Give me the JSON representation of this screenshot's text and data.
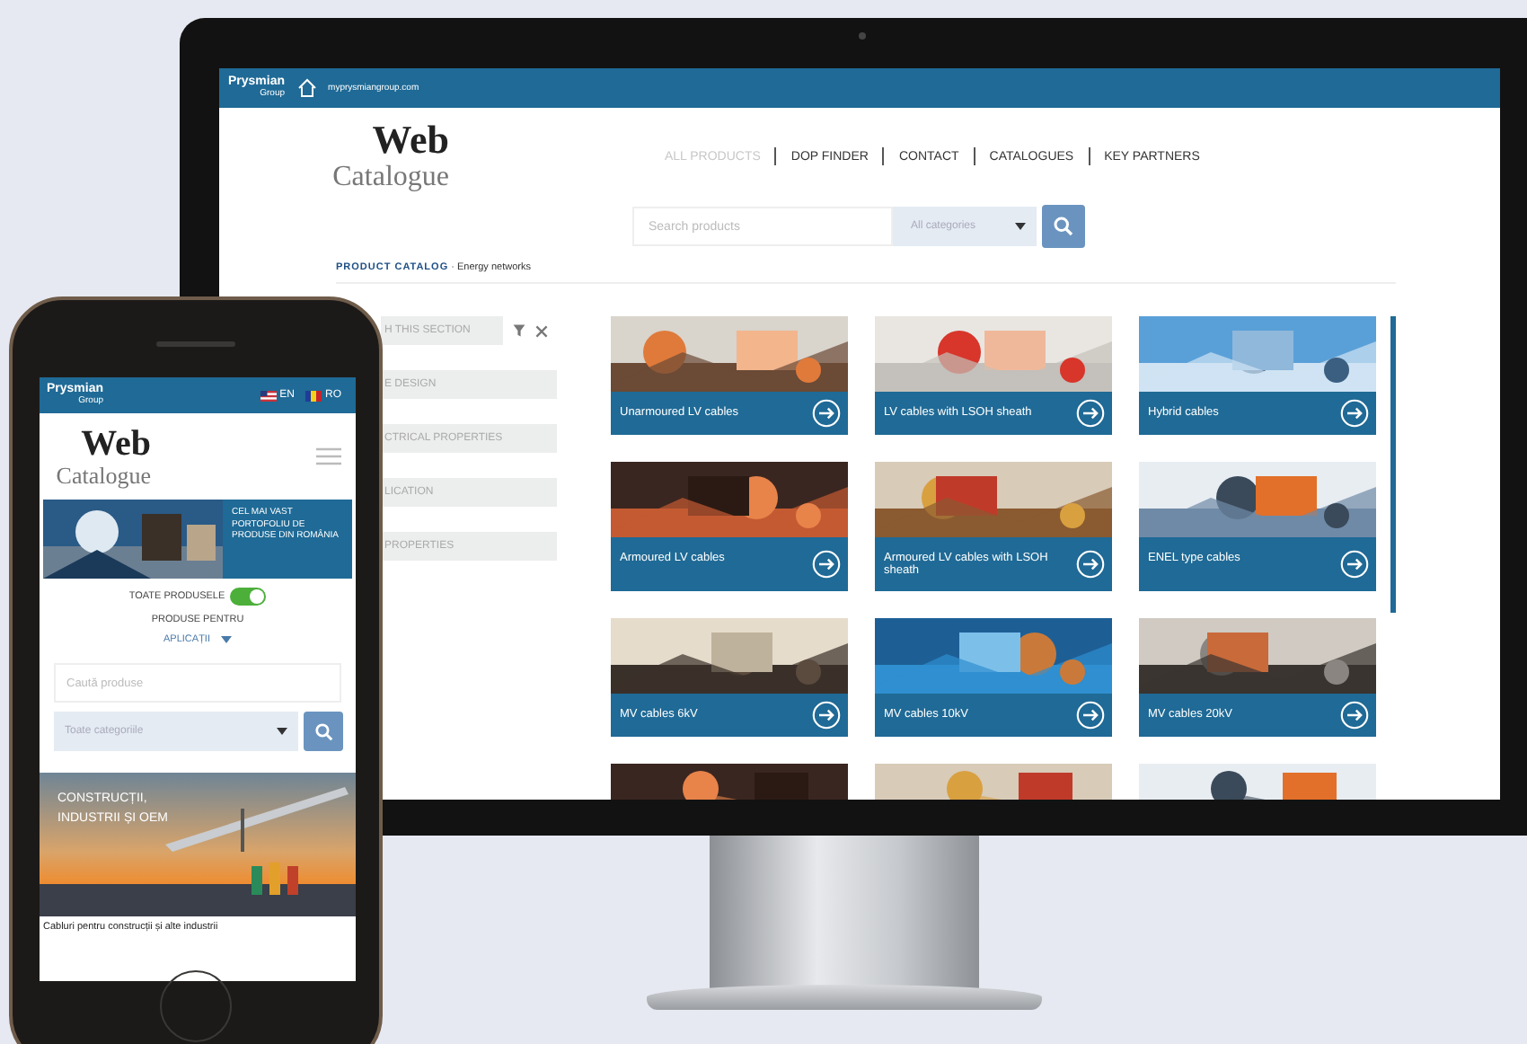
{
  "monitor": {
    "top_bar": {
      "logo": [
        "Prysmian",
        "Group"
      ],
      "url": "myprysmiangroup.com"
    },
    "logo": {
      "title": "Web",
      "subtitle": "Catalogue"
    },
    "nav": [
      {
        "label": "ALL PRODUCTS",
        "selected": true
      },
      {
        "label": "DOP FINDER",
        "selected": false
      },
      {
        "label": "CONTACT",
        "selected": false
      },
      {
        "label": "CATALOGUES",
        "selected": false
      },
      {
        "label": "KEY PARTNERS",
        "selected": false
      }
    ],
    "search": {
      "placeholder": "Search products",
      "category": "All categories"
    },
    "breadcrumb": {
      "section": "PRODUCT CATALOG",
      "separator": "·",
      "page": "Energy networks"
    },
    "sidebar": {
      "filter_heading": "H THIS SECTION",
      "items": [
        "E DESIGN",
        "CTRICAL PROPERTIES",
        "LICATION",
        "PROPERTIES"
      ]
    },
    "products": [
      {
        "name": "Unarmoured LV cables"
      },
      {
        "name": "LV cables with LSOH sheath"
      },
      {
        "name": "Hybrid cables"
      },
      {
        "name": "Armoured LV cables"
      },
      {
        "name": "Armoured LV cables with LSOH sheath"
      },
      {
        "name": "ENEL type cables"
      },
      {
        "name": "MV cables 6kV"
      },
      {
        "name": "MV cables 10kV"
      },
      {
        "name": "MV cables 20kV"
      }
    ]
  },
  "phone": {
    "top_bar": {
      "logo": [
        "Prysmian",
        "Group"
      ],
      "languages": [
        "EN",
        "RO"
      ]
    },
    "logo": {
      "title": "Web",
      "subtitle": "Catalogue"
    },
    "banner": {
      "text": "CEL MAI VAST PORTOFOLIU DE PRODUSE DIN ROMÂNIA"
    },
    "toggle": {
      "label": "TOATE PRODUSELE",
      "on": true
    },
    "filter_label": "PRODUSE PENTRU",
    "filter_link": "APLICAȚII",
    "search": {
      "placeholder": "Caută produse",
      "category": "Toate categoriile"
    },
    "feature": {
      "title": "CONSTRUCȚII, INDUSTRII ȘI OEM",
      "caption": "Cabluri pentru construcții și alte industrii"
    }
  }
}
